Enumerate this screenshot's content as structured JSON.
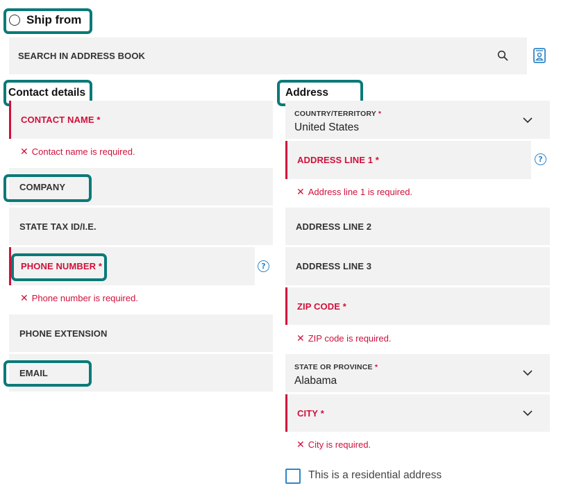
{
  "ship_from": {
    "label": "Ship from"
  },
  "search": {
    "label": "SEARCH IN ADDRESS BOOK"
  },
  "contact": {
    "title": "Contact details",
    "name_label": "CONTACT NAME",
    "name_error": "Contact name is required.",
    "company_label": "COMPANY",
    "tax_label": "STATE TAX ID/I.E.",
    "phone_label": "PHONE NUMBER",
    "phone_error": "Phone number is required.",
    "extension_label": "PHONE EXTENSION",
    "email_label": "EMAIL"
  },
  "address": {
    "title": "Address",
    "country_label": "COUNTRY/TERRITORY",
    "country_value": "United States",
    "line1_label": "ADDRESS LINE 1",
    "line1_error": "Address line 1 is required.",
    "line2_label": "ADDRESS LINE 2",
    "line3_label": "ADDRESS LINE 3",
    "zip_label": "ZIP CODE",
    "zip_error": "ZIP code is required.",
    "state_label": "STATE OR PROVINCE",
    "state_value": "Alabama",
    "city_label": "CITY",
    "city_error": "City is required.",
    "residential_label": "This is a residential address"
  },
  "required_marker": "*",
  "error_marker": "✕",
  "help_glyph": "?",
  "colors": {
    "error": "#d0103a",
    "highlight": "#0b7a78",
    "link": "#2f86c8",
    "field_bg": "#f2f2f2"
  },
  "icons": [
    "radio-icon",
    "search-icon",
    "address-book-icon",
    "chevron-down-icon",
    "help-icon",
    "checkbox-icon"
  ]
}
